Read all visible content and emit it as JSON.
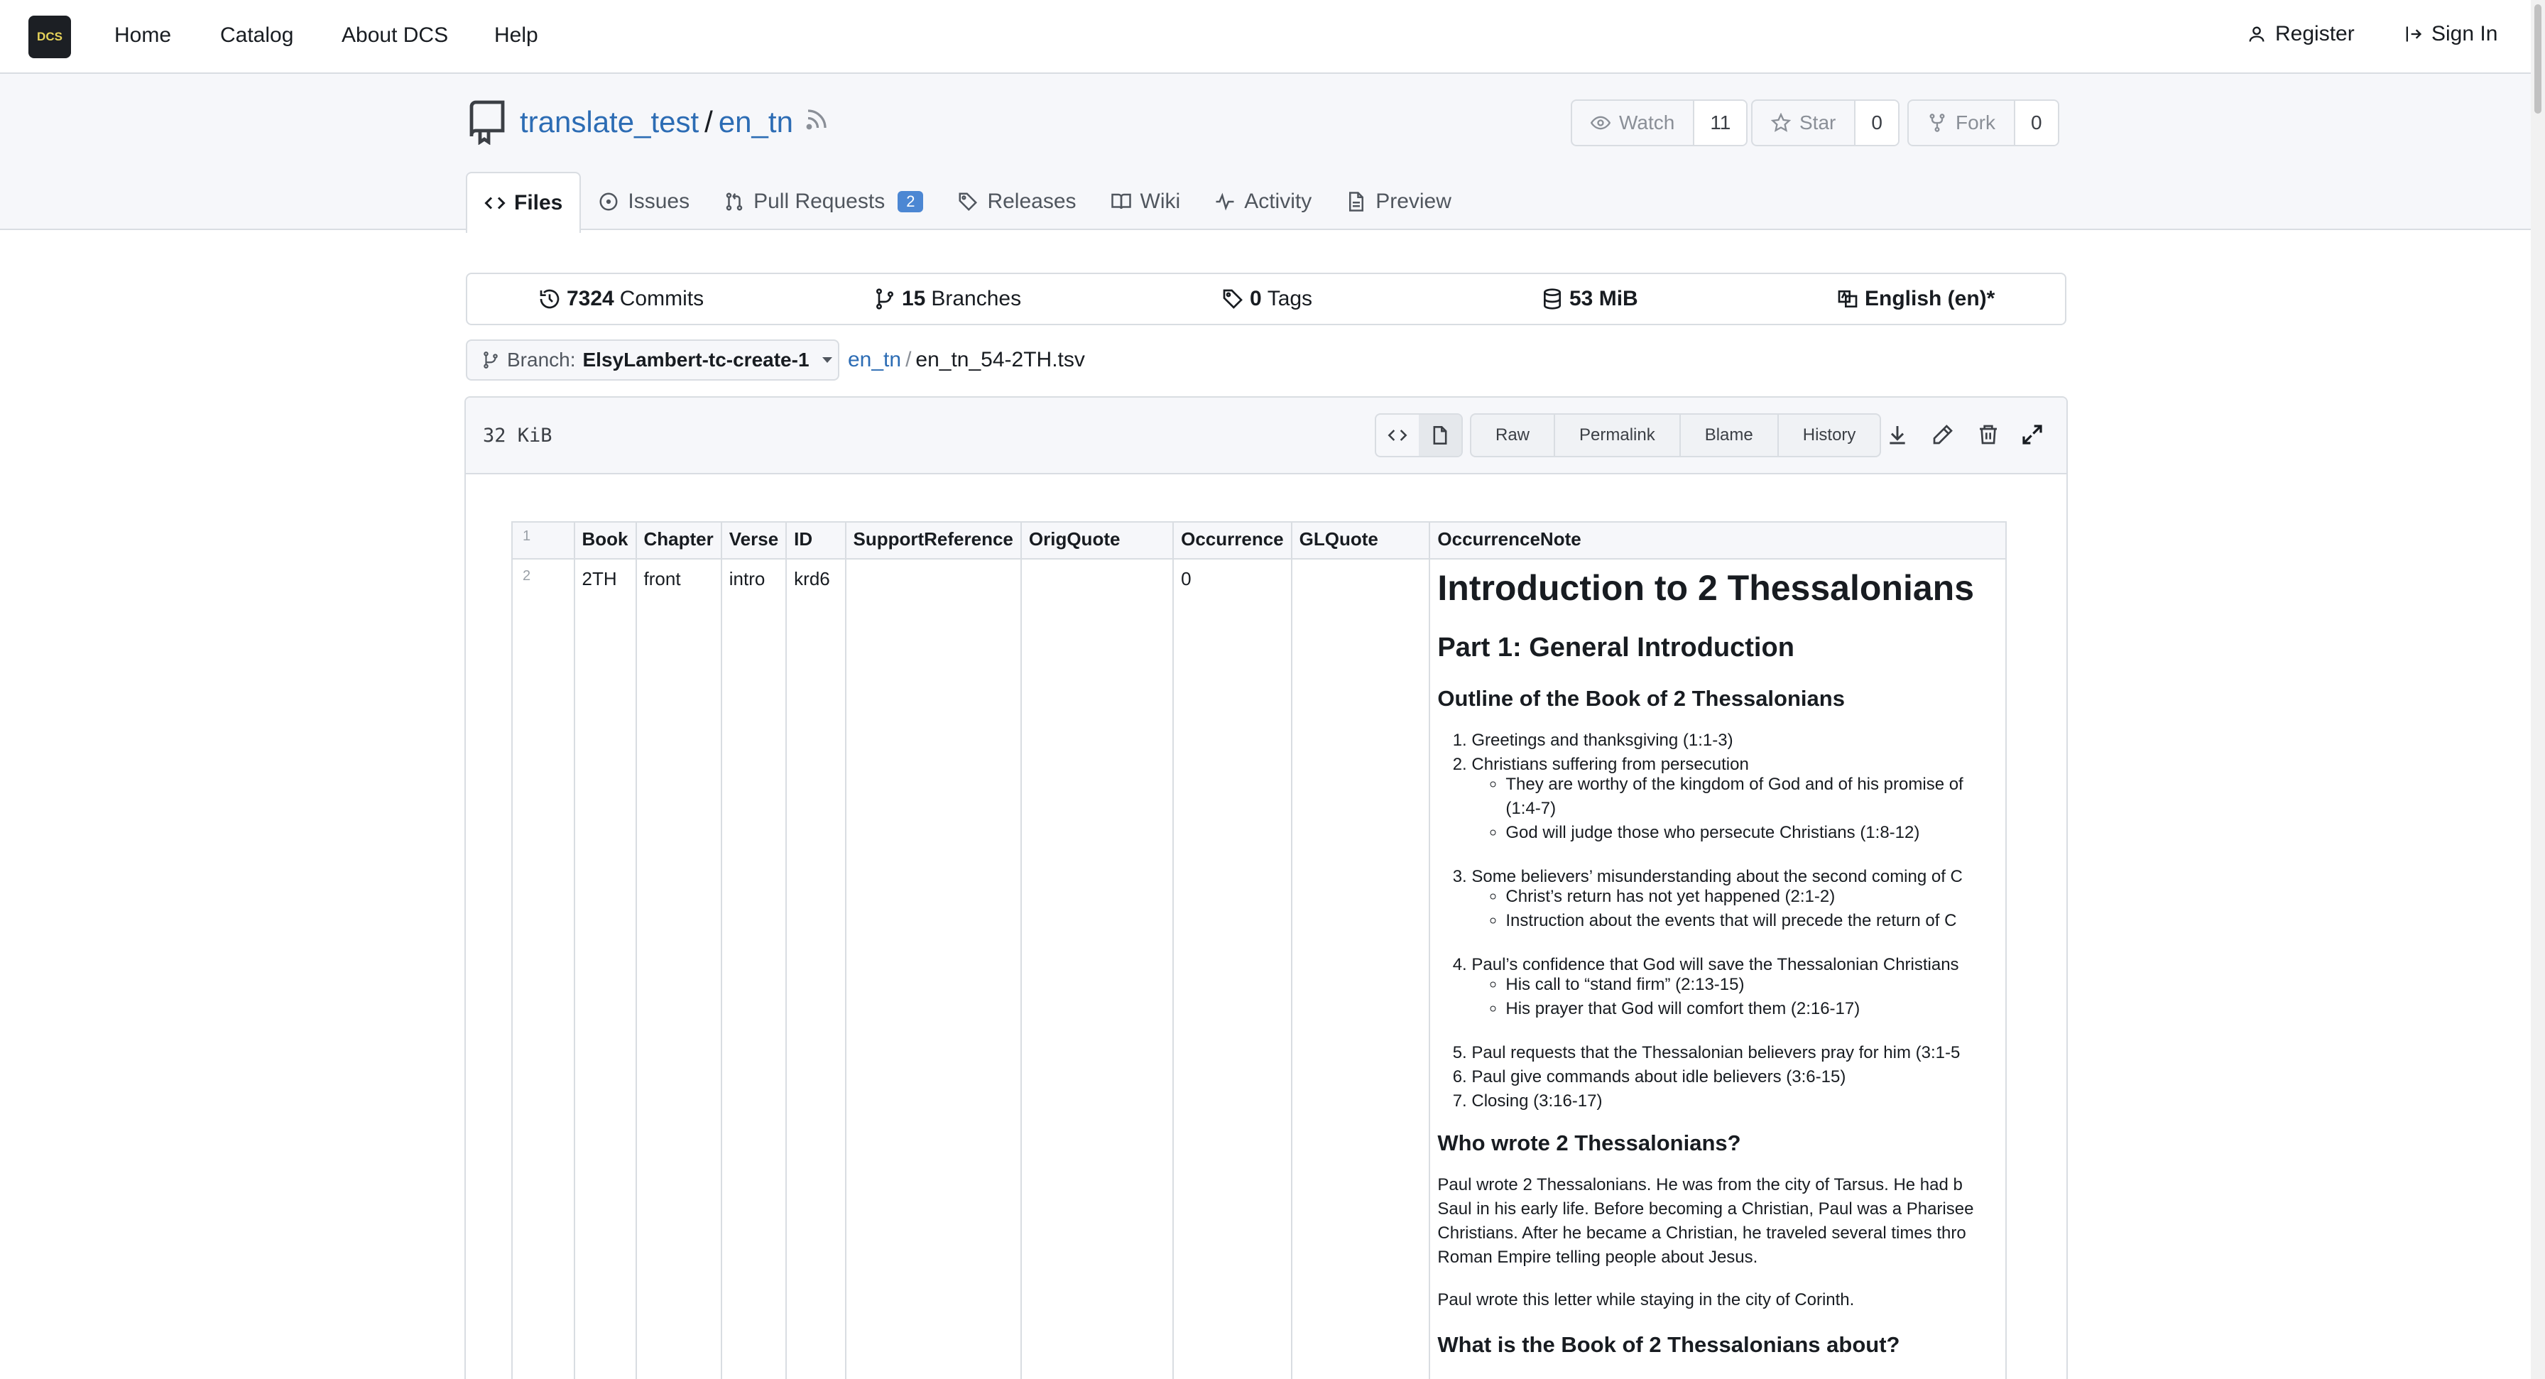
{
  "nav": {
    "logo_text": "DCS",
    "items": [
      "Home",
      "Catalog",
      "About DCS",
      "Help"
    ],
    "register": "Register",
    "sign_in": "Sign In"
  },
  "repo": {
    "owner": "translate_test",
    "separator": "/",
    "name": "en_tn",
    "watch": {
      "label": "Watch",
      "count": "11"
    },
    "star": {
      "label": "Star",
      "count": "0"
    },
    "fork": {
      "label": "Fork",
      "count": "0"
    }
  },
  "tabs": {
    "files": "Files",
    "issues": "Issues",
    "pulls": "Pull Requests",
    "pulls_count": "2",
    "releases": "Releases",
    "wiki": "Wiki",
    "activity": "Activity",
    "preview": "Preview"
  },
  "stats": {
    "commits_num": "7324",
    "commits_label": "Commits",
    "branches_num": "15",
    "branches_label": "Branches",
    "tags_num": "0",
    "tags_label": "Tags",
    "size": "53 MiB",
    "language": "English (en)*"
  },
  "branch": {
    "prefix": "Branch:",
    "name": "ElsyLambert-tc-create-1"
  },
  "path": {
    "repo": "en_tn",
    "sep": "/",
    "file": "en_tn_54-2TH.tsv"
  },
  "file": {
    "size": "32 KiB",
    "actions": [
      "Raw",
      "Permalink",
      "Blame",
      "History"
    ]
  },
  "table": {
    "header_line": "1",
    "columns": [
      "Book",
      "Chapter",
      "Verse",
      "ID",
      "SupportReference",
      "OrigQuote",
      "Occurrence",
      "GLQuote",
      "OccurrenceNote"
    ],
    "row": {
      "line": "2",
      "book": "2TH",
      "chapter": "front",
      "verse": "intro",
      "id": "krd6",
      "support_reference": "",
      "orig_quote": "",
      "occurrence": "0",
      "gl_quote": ""
    }
  },
  "note": {
    "h1": "Introduction to 2 Thessalonians",
    "h2": "Part 1: General Introduction",
    "outline_heading": "Outline of the Book of 2 Thessalonians",
    "outline": {
      "i1": "Greetings and thanksgiving (1:1-3)",
      "i2": "Christians suffering from persecution",
      "i2a": "They are worthy of the kingdom of God and of his promise of",
      "i2a_cont": "(1:4-7)",
      "i2b": "God will judge those who persecute Christians (1:8-12)",
      "i3": "Some believers’ misunderstanding about the second coming of C",
      "i3a": "Christ’s return has not yet happened (2:1-2)",
      "i3b": "Instruction about the events that will precede the return of C",
      "i4": "Paul’s confidence that God will save the Thessalonian Christians",
      "i4a": "His call to “stand firm” (2:13-15)",
      "i4b": "His prayer that God will comfort them (2:16-17)",
      "i5": "Paul requests that the Thessalonian believers pray for him (3:1-5",
      "i6": "Paul give commands about idle believers (3:6-15)",
      "i7": "Closing (3:16-17)"
    },
    "who_heading": "Who wrote 2 Thessalonians?",
    "who_p1_l1": "Paul wrote 2 Thessalonians. He was from the city of Tarsus. He had b",
    "who_p1_l2": "Saul in his early life. Before becoming a Christian, Paul was a Pharisee",
    "who_p1_l3": "Christians. After he became a Christian, he traveled several times thro",
    "who_p1_l4": "Roman Empire telling people about Jesus.",
    "who_p2": "Paul wrote this letter while staying in the city of Corinth.",
    "about_heading": "What is the Book of 2 Thessalonians about?"
  }
}
